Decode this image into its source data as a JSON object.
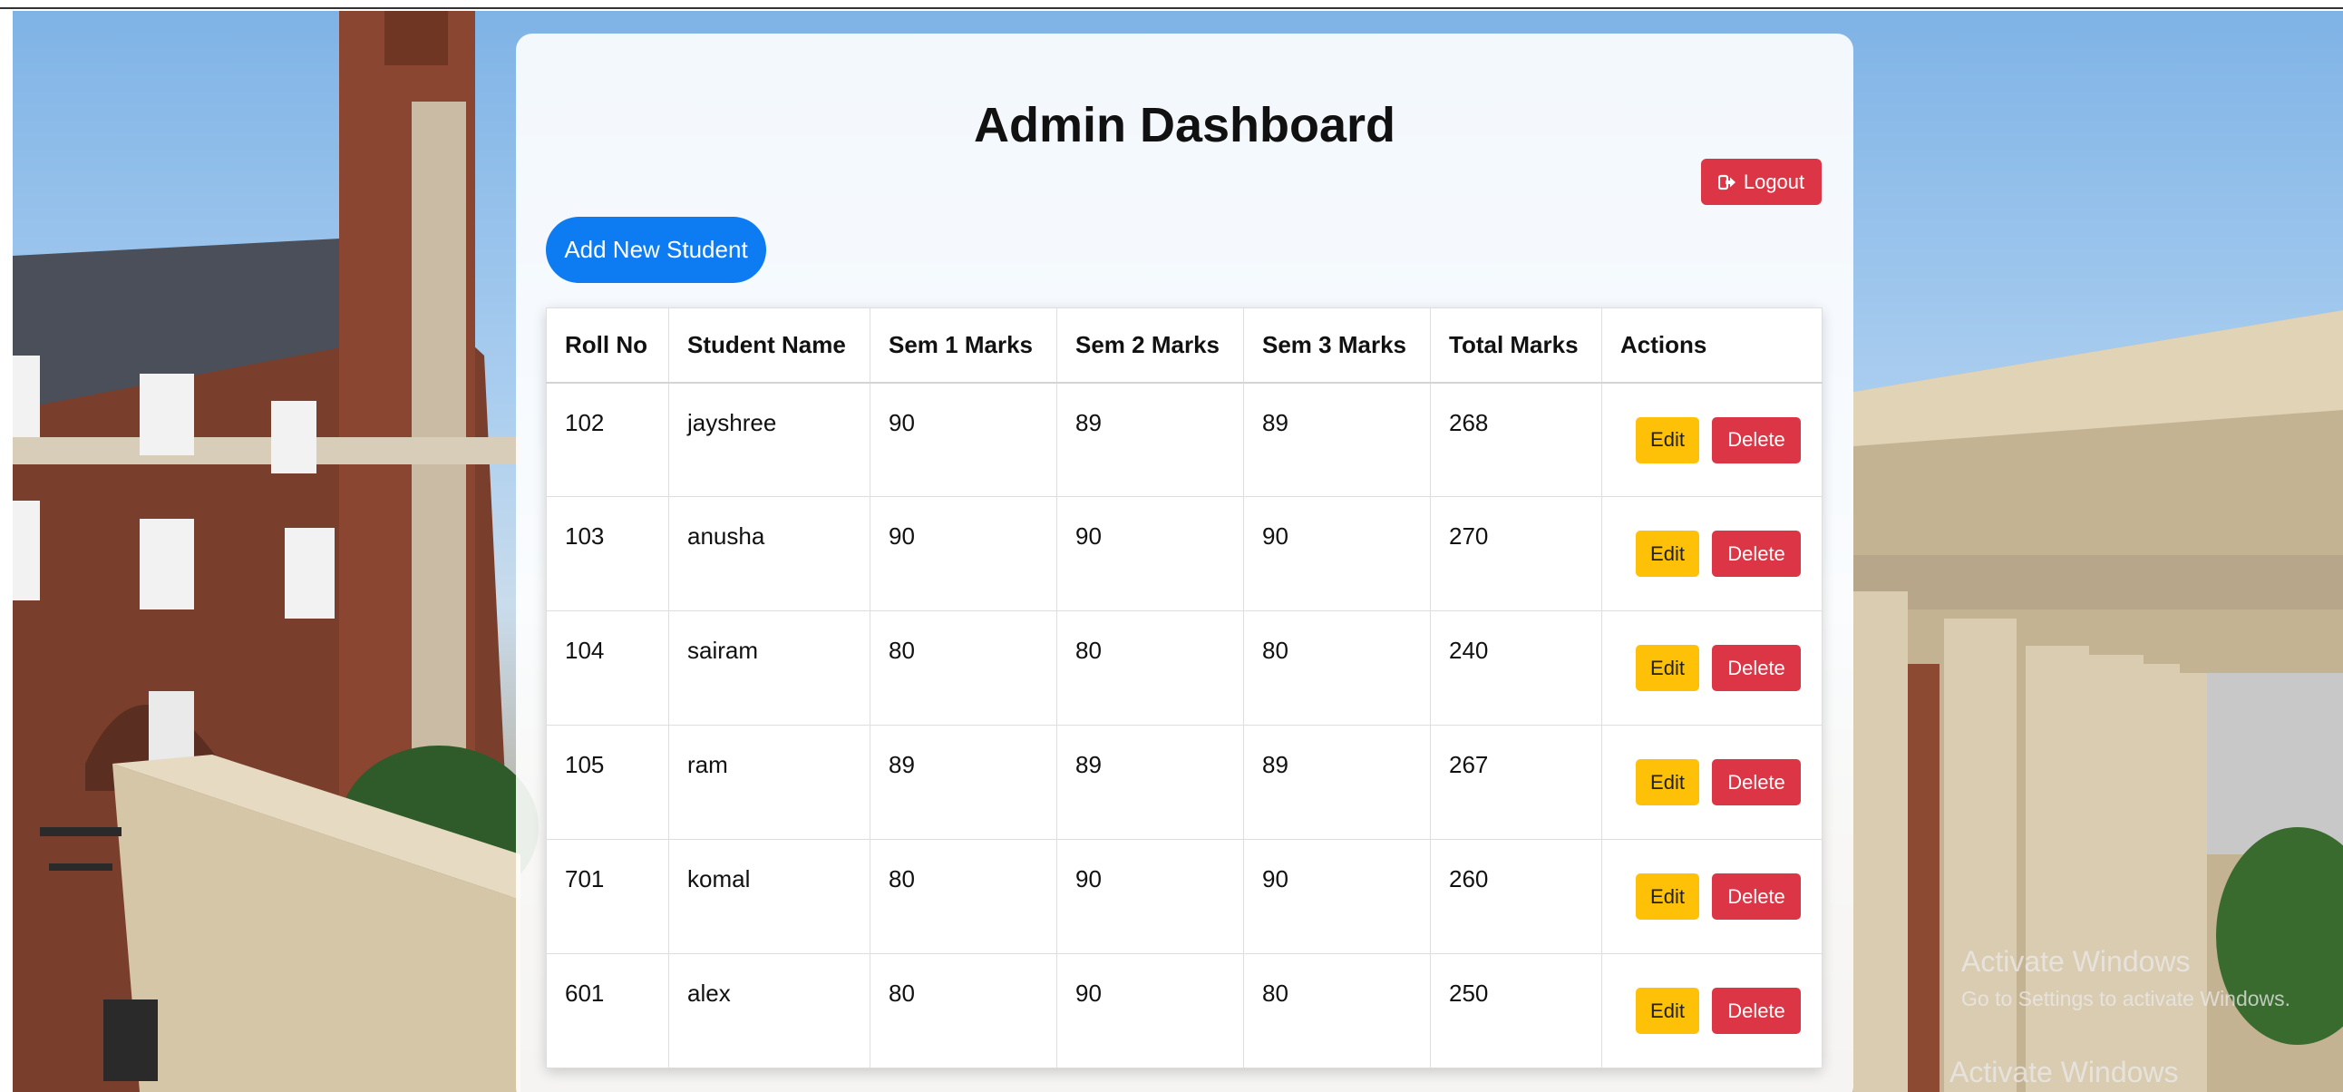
{
  "header": {
    "title": "Admin Dashboard",
    "logout_label": "Logout",
    "add_student_label": "Add New Student"
  },
  "table": {
    "columns": [
      "Roll No",
      "Student Name",
      "Sem 1 Marks",
      "Sem 2 Marks",
      "Sem 3 Marks",
      "Total Marks",
      "Actions"
    ],
    "rows": [
      {
        "roll": "102",
        "name": "jayshree",
        "sem1": "90",
        "sem2": "89",
        "sem3": "89",
        "total": "268"
      },
      {
        "roll": "103",
        "name": "anusha",
        "sem1": "90",
        "sem2": "90",
        "sem3": "90",
        "total": "270"
      },
      {
        "roll": "104",
        "name": "sairam",
        "sem1": "80",
        "sem2": "80",
        "sem3": "80",
        "total": "240"
      },
      {
        "roll": "105",
        "name": "ram",
        "sem1": "89",
        "sem2": "89",
        "sem3": "89",
        "total": "267"
      },
      {
        "roll": "701",
        "name": "komal",
        "sem1": "80",
        "sem2": "90",
        "sem3": "90",
        "total": "260"
      },
      {
        "roll": "601",
        "name": "alex",
        "sem1": "80",
        "sem2": "90",
        "sem3": "80",
        "total": "250"
      }
    ],
    "edit_label": "Edit",
    "delete_label": "Delete"
  },
  "watermark": {
    "line1": "Activate Windows",
    "line2": "Go to Settings to activate Windows.",
    "line3": "Activate Windows"
  },
  "colors": {
    "primary": "#0d7bf2",
    "danger": "#dc3545",
    "warning": "#ffc107"
  },
  "icons": {
    "logout": "logout-icon"
  }
}
